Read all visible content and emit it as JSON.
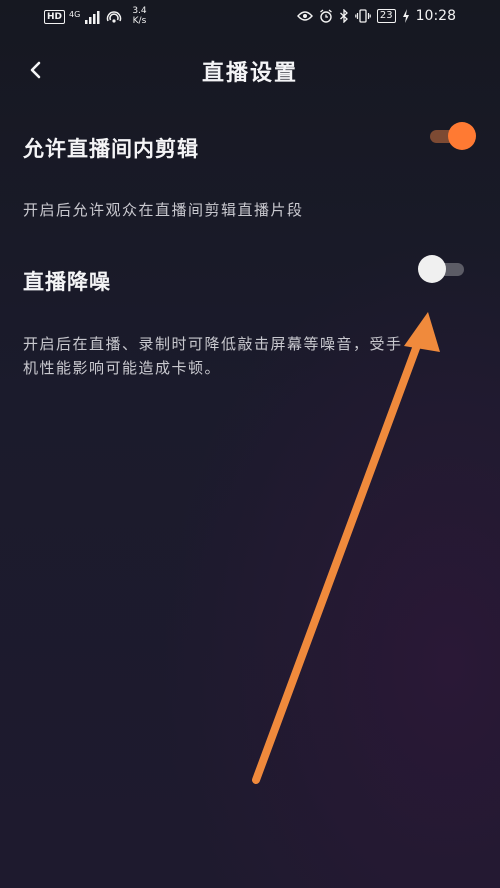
{
  "status_bar": {
    "hd": "HD",
    "network": "4G",
    "speed_value": "3.4",
    "speed_unit": "K/s",
    "battery": "23",
    "time": "10:28"
  },
  "header": {
    "title": "直播设置"
  },
  "settings": [
    {
      "label": "允许直播间内剪辑",
      "enabled": true,
      "description": "开启后允许观众在直播间剪辑直播片段"
    },
    {
      "label": "直播降噪",
      "enabled": false,
      "description_line1": "开启后在直播、录制时可降低敲击屏幕等噪音，受手",
      "description_line2": "机性能影响可能造成卡顿。"
    }
  ],
  "colors": {
    "accent": "#ff7a33",
    "annotation_arrow": "#f08a3c"
  },
  "icons": [
    "back-arrow-icon",
    "eye-icon",
    "alarm-icon",
    "bluetooth-icon",
    "vibrate-icon",
    "charging-icon",
    "signal-icon",
    "hotspot-icon"
  ]
}
